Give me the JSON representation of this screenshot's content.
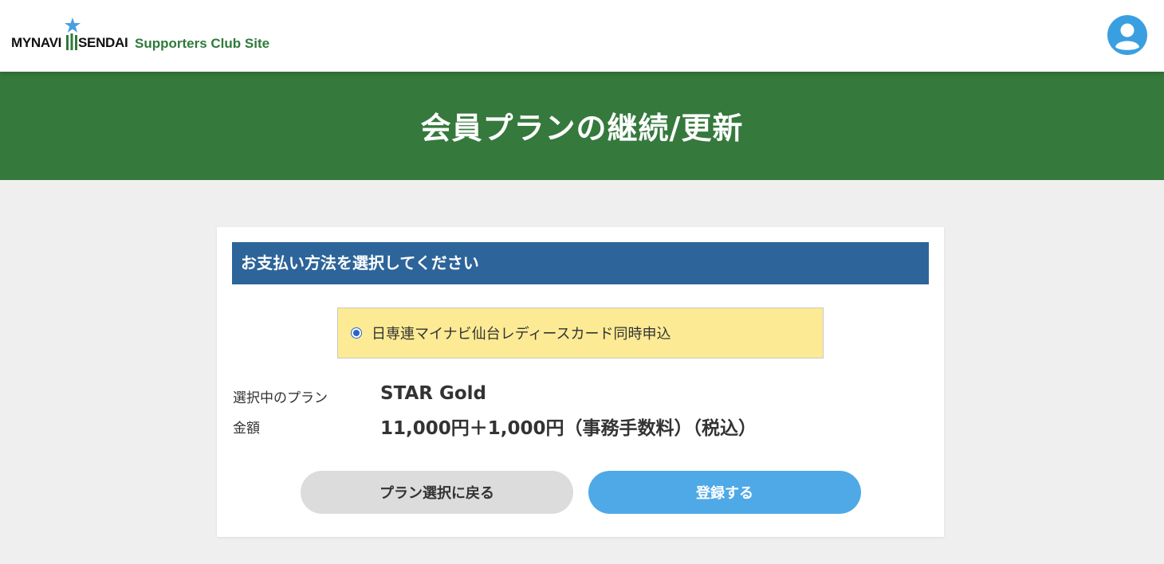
{
  "header": {
    "logo": {
      "brand_left": "MYNAVI",
      "brand_right": "SENDAI",
      "subtitle": "Supporters Club Site"
    },
    "account_icon": "user-circle-icon"
  },
  "banner": {
    "title": "会員プランの継続/更新"
  },
  "payment": {
    "heading": "お支払い方法を選択してください",
    "options": [
      {
        "label": "日専連マイナビ仙台レディースカード同時申込",
        "selected": true
      }
    ]
  },
  "summary": {
    "plan_label": "選択中のプラン",
    "plan_value": "STAR Gold",
    "amount_label": "金額",
    "amount_value": "11,000円＋1,000円（事務手数料）（税込）"
  },
  "actions": {
    "back_label": "プラン選択に戻る",
    "submit_label": "登録する"
  },
  "colors": {
    "header_bg": "#ffffff",
    "banner_bg": "#35793c",
    "section_head_bg": "#2d6499",
    "option_bg": "#fceb94",
    "submit_bg": "#4fa9e7",
    "back_bg": "#dcdcdc",
    "page_bg": "#efefef",
    "logo_green": "#2f7a3b",
    "logo_star": "#4a9fe0"
  }
}
